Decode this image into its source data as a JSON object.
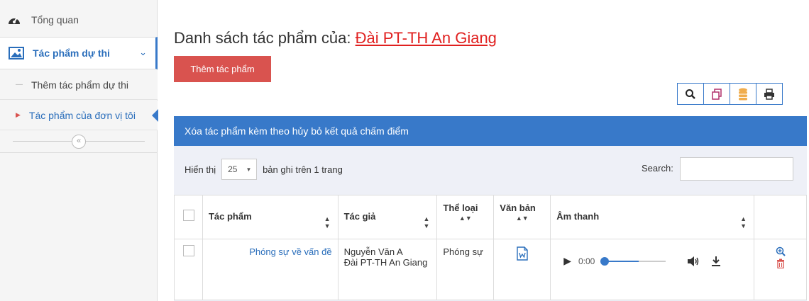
{
  "sidebar": {
    "overview_label": "Tổng quan",
    "active_label": "Tác phẩm dự thi",
    "sub_items": [
      "Thêm tác phẩm dự thi",
      "Tác phẩm của đơn vị tôi"
    ],
    "collapse_glyph": "«"
  },
  "page": {
    "title_prefix": "Danh sách tác phẩm của:",
    "org_name": "Đài PT-TH An Giang",
    "add_button": "Thêm tác phẩm",
    "banner": "Xóa tác phẩm kèm theo hủy bỏ kết quả chấm điểm"
  },
  "toolbar": {
    "icons": [
      "search-icon",
      "copy-icon",
      "database-icon",
      "print-icon"
    ]
  },
  "table_controls": {
    "show_label": "Hiển thị",
    "page_length": "25",
    "records_label": "bản ghi trên 1 trang",
    "search_label": "Search:"
  },
  "table": {
    "headers": [
      "Tác phẩm",
      "Tác giả",
      "Thể loại",
      "Văn bản",
      "Âm thanh"
    ],
    "rows": [
      {
        "work": "Phóng sự về vấn đề",
        "author_name": "Nguyễn Văn A",
        "author_org": "Đài PT-TH An Giang",
        "genre": "Phóng sự",
        "audio_time": "0:00"
      }
    ]
  },
  "colors": {
    "accent": "#3879c9",
    "danger": "#d9534f",
    "org_link": "#e0201f"
  }
}
